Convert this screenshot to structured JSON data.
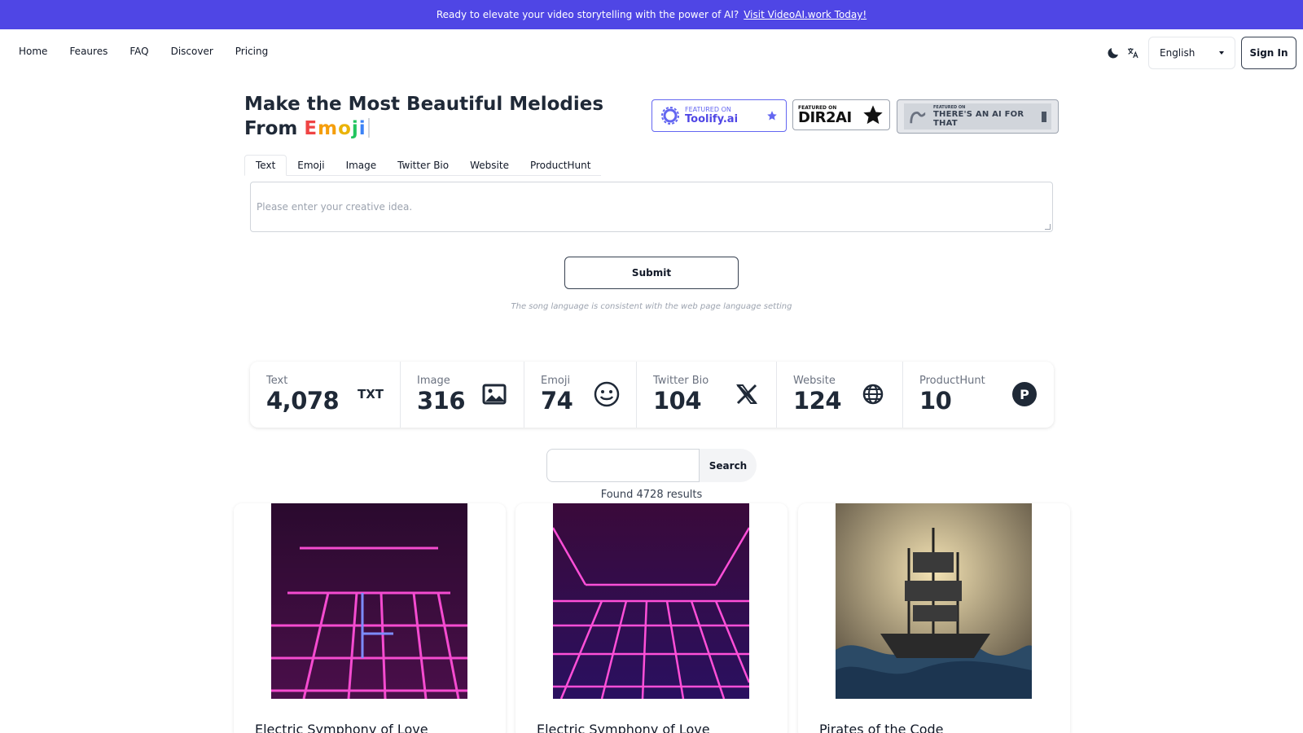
{
  "banner": {
    "text": "Ready to elevate your video storytelling with the power of AI?",
    "link": "Visit VideoAI.work Today!"
  },
  "nav": {
    "links": [
      "Home",
      "Feaures",
      "FAQ",
      "Discover",
      "Pricing"
    ],
    "language": "English",
    "signin": "Sign In"
  },
  "hero": {
    "line1": "Make the Most Beautiful Melodies",
    "line2_prefix": "From",
    "word_letters": [
      "E",
      "m",
      "o",
      "j",
      "i"
    ]
  },
  "badges": {
    "toolify_small": "FEATURED ON",
    "toolify_name": "Toolify.ai",
    "dir_small": "FEATURED ON",
    "dir_name": "DIR2AI",
    "taaft_small": "FEATURED ON",
    "taaft_name": "THERE'S AN AI FOR THAT"
  },
  "tabs": [
    "Text",
    "Emoji",
    "Image",
    "Twitter Bio",
    "Website",
    "ProductHunt"
  ],
  "idea": {
    "placeholder": "Please enter your creative idea."
  },
  "submit": "Submit",
  "note": "The song language is consistent with the web page language setting",
  "stats": [
    {
      "label": "Text",
      "value": "4,078",
      "icon": "txt-icon",
      "icon_text": "TXT"
    },
    {
      "label": "Image",
      "value": "316",
      "icon": "image-icon"
    },
    {
      "label": "Emoji",
      "value": "74",
      "icon": "smiley-icon"
    },
    {
      "label": "Twitter Bio",
      "value": "104",
      "icon": "x-logo-icon"
    },
    {
      "label": "Website",
      "value": "124",
      "icon": "globe-icon"
    },
    {
      "label": "ProductHunt",
      "value": "10",
      "icon": "producthunt-icon",
      "icon_text": "P"
    }
  ],
  "search": {
    "button": "Search",
    "found": "Found 4728 results"
  },
  "cards": [
    {
      "title": "Electric Symphony of Love",
      "image": "neon grid"
    },
    {
      "title": "Electric Symphony of Love",
      "image": "neon grid"
    },
    {
      "title": "Pirates of the Code",
      "image": "pirate ship"
    }
  ],
  "colors": {
    "banner": "#4f46e5",
    "accent": "#6366f1",
    "text": "#1f2937"
  }
}
